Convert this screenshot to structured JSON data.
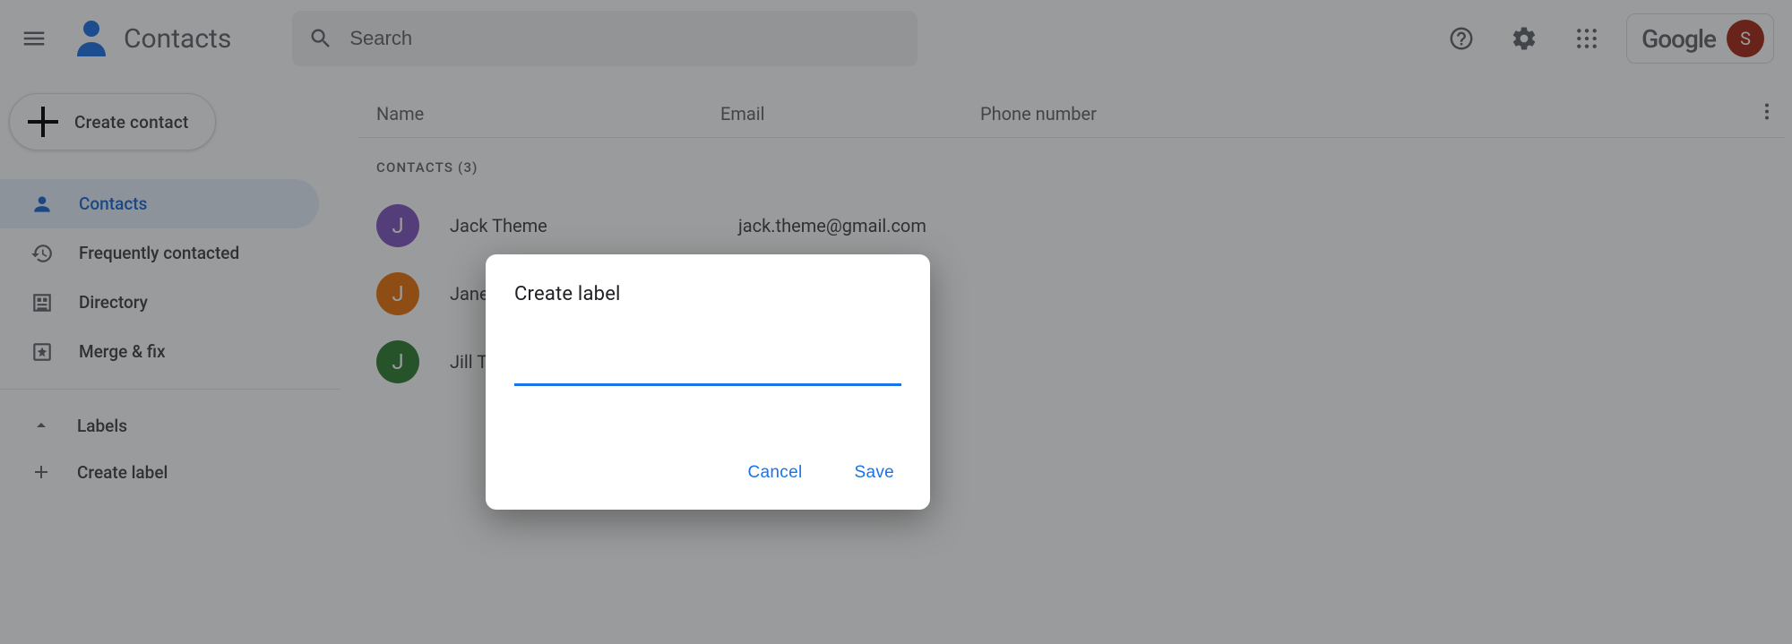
{
  "header": {
    "app_title": "Contacts",
    "search_placeholder": "Search",
    "brand_word": "Google",
    "avatar_letter": "S"
  },
  "sidebar": {
    "create_label": "Create contact",
    "items": [
      {
        "label": "Contacts"
      },
      {
        "label": "Frequently contacted"
      },
      {
        "label": "Directory"
      },
      {
        "label": "Merge & fix"
      }
    ],
    "labels_header": "Labels",
    "create_label_item": "Create label"
  },
  "columns": {
    "name": "Name",
    "email": "Email",
    "phone": "Phone number"
  },
  "section_label": "CONTACTS (3)",
  "contacts": [
    {
      "initial": "J",
      "name": "Jack Theme",
      "email": "jack.theme@gmail.com",
      "avatar_color": "#7e57c2"
    },
    {
      "initial": "J",
      "name": "Jane",
      "email": "",
      "avatar_color": "#e8710a"
    },
    {
      "initial": "J",
      "name": "Jill T",
      "email": "",
      "avatar_color": "#2e7d32"
    }
  ],
  "dialog": {
    "title": "Create label",
    "input_value": "",
    "cancel": "Cancel",
    "save": "Save"
  }
}
